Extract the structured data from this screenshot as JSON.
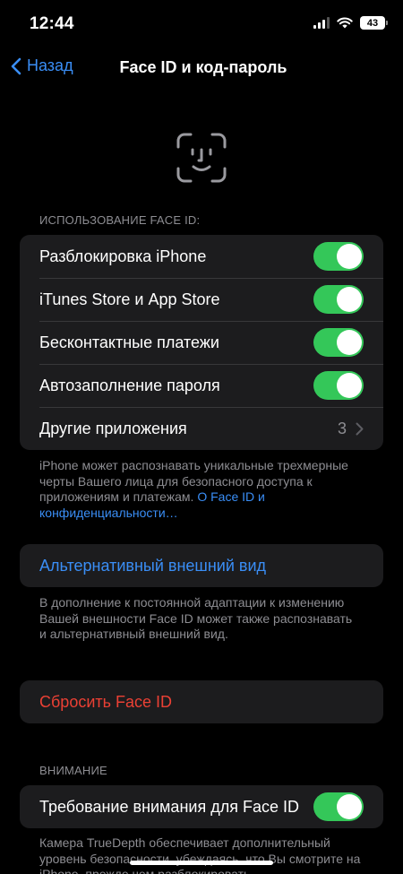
{
  "status": {
    "time": "12:44",
    "battery": "43"
  },
  "nav": {
    "back_label": "Назад",
    "title": "Face ID и код-пароль"
  },
  "faceid_section": {
    "header": "ИСПОЛЬЗОВАНИЕ FACE ID:",
    "rows": [
      {
        "label": "Разблокировка iPhone",
        "toggle": true
      },
      {
        "label": "iTunes Store и App Store",
        "toggle": true
      },
      {
        "label": "Бесконтактные платежи",
        "toggle": true
      },
      {
        "label": "Автозаполнение пароля",
        "toggle": true
      }
    ],
    "other_apps": {
      "label": "Другие приложения",
      "value": "3"
    },
    "footer_text": "iPhone может распознавать уникальные трехмерные черты Вашего лица для безопасного доступа к приложениям и платежам.",
    "footer_link": "О Face ID и конфиденциальности…"
  },
  "alternate": {
    "label": "Альтернативный внешний вид",
    "footer_text": "В дополнение к постоянной адаптации к изменению Вашей внешности Face ID может также распознавать и альтернативный внешний вид."
  },
  "reset": {
    "label": "Сбросить Face ID"
  },
  "attention_section": {
    "header": "ВНИМАНИЕ",
    "row": {
      "label": "Требование внимания для Face ID",
      "toggle": true
    },
    "footer_text": "Камера TrueDepth обеспечивает дополнительный уровень безопасности, убеждаясь, что Вы смотрите на iPhone, прежде чем разблокировать"
  },
  "colors": {
    "accent": "#3a8ef6",
    "toggle_on": "#34c759",
    "destructive": "#eb4034",
    "cell_bg": "#1c1c1e"
  }
}
